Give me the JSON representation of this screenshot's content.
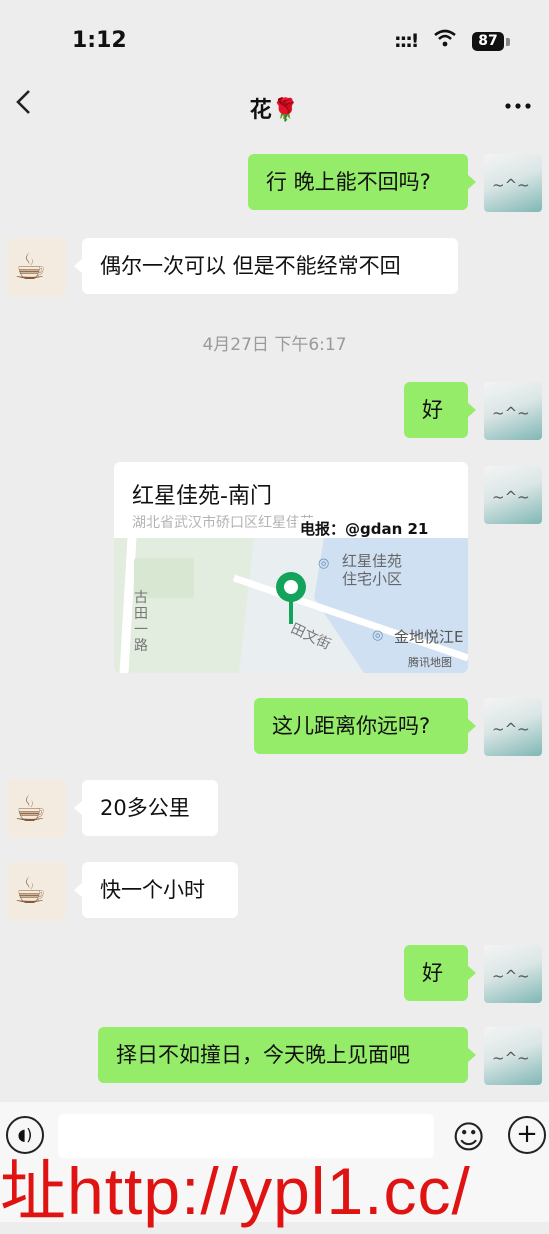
{
  "status_bar": {
    "time": "1:12",
    "signal": ":::!",
    "battery": "87"
  },
  "header": {
    "title": "花",
    "title_emoji": "🌹"
  },
  "messages": [
    {
      "text": "行 晚上能不回吗?"
    },
    {
      "text": "偶尔一次可以 但是不能经常不回"
    },
    {
      "text": "好"
    },
    {
      "text": "这儿距离你远吗?"
    },
    {
      "text": "20多公里"
    },
    {
      "text": "快一个小时"
    },
    {
      "text": "好"
    },
    {
      "text": "择日不如撞日，今天晚上见面吧"
    }
  ],
  "timestamp": "4月27日 下午6:17",
  "location": {
    "title": "红星佳苑-南门",
    "address": "湖北省武汉市硚口区红星佳苑",
    "overlay": "电报：@gdan 21",
    "map_labels": {
      "poi1_line1": "红星佳苑",
      "poi1_line2": "住宅小区",
      "poi2": "金地悦江E",
      "road1": "古田一路",
      "road2": "田文街",
      "provider": "腾讯地图"
    }
  },
  "watermark": "址http://ypl1.cc/"
}
